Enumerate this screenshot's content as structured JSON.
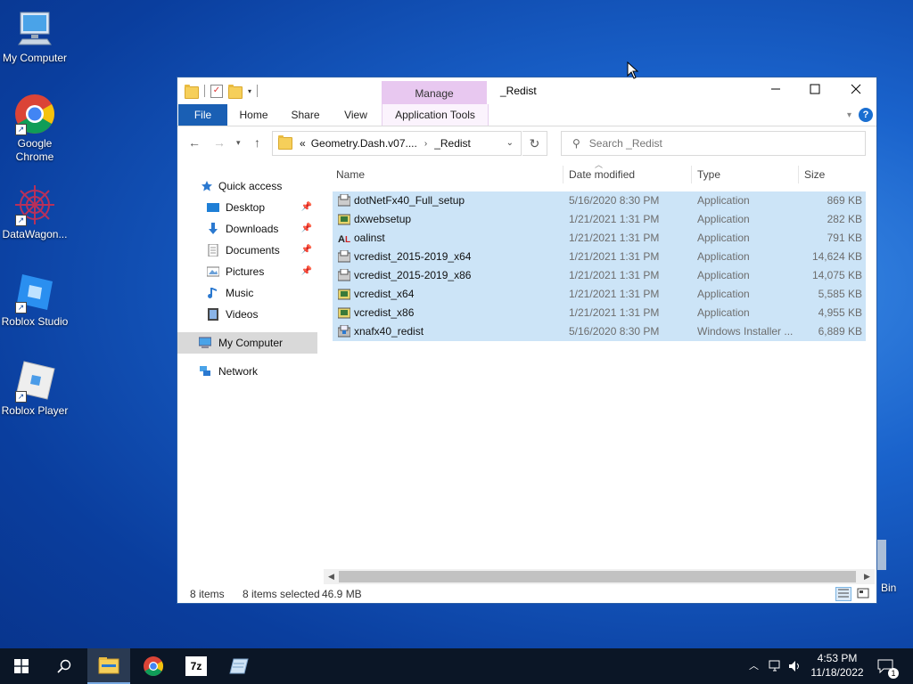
{
  "desktop": {
    "icons": [
      {
        "label": "My Computer"
      },
      {
        "label": "Google Chrome"
      },
      {
        "label": "DataWagon..."
      },
      {
        "label": "Roblox Studio"
      },
      {
        "label": "Roblox Player"
      }
    ],
    "recycle_label": "Bin"
  },
  "window": {
    "manage_tab": "Manage",
    "title": "_Redist",
    "ribbon_tabs": {
      "file": "File",
      "home": "Home",
      "share": "Share",
      "view": "View",
      "app_tools": "Application Tools"
    },
    "address": {
      "prefix": "«",
      "crumb1": "Geometry.Dash.v07....",
      "crumb2": "_Redist"
    },
    "search_placeholder": "Search _Redist",
    "nav": {
      "quick_access": "Quick access",
      "desktop": "Desktop",
      "downloads": "Downloads",
      "documents": "Documents",
      "pictures": "Pictures",
      "music": "Music",
      "videos": "Videos",
      "my_computer": "My Computer",
      "network": "Network"
    },
    "columns": {
      "name": "Name",
      "date": "Date modified",
      "type": "Type",
      "size": "Size"
    },
    "files": [
      {
        "name": "dotNetFx40_Full_setup",
        "date": "5/16/2020 8:30 PM",
        "type": "Application",
        "size": "869 KB"
      },
      {
        "name": "dxwebsetup",
        "date": "1/21/2021 1:31 PM",
        "type": "Application",
        "size": "282 KB"
      },
      {
        "name": "oalinst",
        "date": "1/21/2021 1:31 PM",
        "type": "Application",
        "size": "791 KB"
      },
      {
        "name": "vcredist_2015-2019_x64",
        "date": "1/21/2021 1:31 PM",
        "type": "Application",
        "size": "14,624 KB"
      },
      {
        "name": "vcredist_2015-2019_x86",
        "date": "1/21/2021 1:31 PM",
        "type": "Application",
        "size": "14,075 KB"
      },
      {
        "name": "vcredist_x64",
        "date": "1/21/2021 1:31 PM",
        "type": "Application",
        "size": "5,585 KB"
      },
      {
        "name": "vcredist_x86",
        "date": "1/21/2021 1:31 PM",
        "type": "Application",
        "size": "4,955 KB"
      },
      {
        "name": "xnafx40_redist",
        "date": "5/16/2020 8:30 PM",
        "type": "Windows Installer ...",
        "size": "6,889 KB"
      }
    ],
    "status": {
      "items": "8 items",
      "selected": "8 items selected",
      "size": "46.9 MB"
    }
  },
  "taskbar": {
    "tray_badge": "1",
    "time": "4:53 PM",
    "date": "11/18/2022",
    "zip_label": "7z"
  },
  "icons": {
    "start": "windows-logo-icon",
    "search": "search-icon",
    "explorer": "file-explorer-icon",
    "chrome": "chrome-icon",
    "sevenzip": "7zip-icon",
    "notes": "notes-icon"
  },
  "colors": {
    "accent": "#1a5fb4",
    "selection": "#cce4f7",
    "manage": "#e8c8f0",
    "taskbar": "#0b1626"
  }
}
